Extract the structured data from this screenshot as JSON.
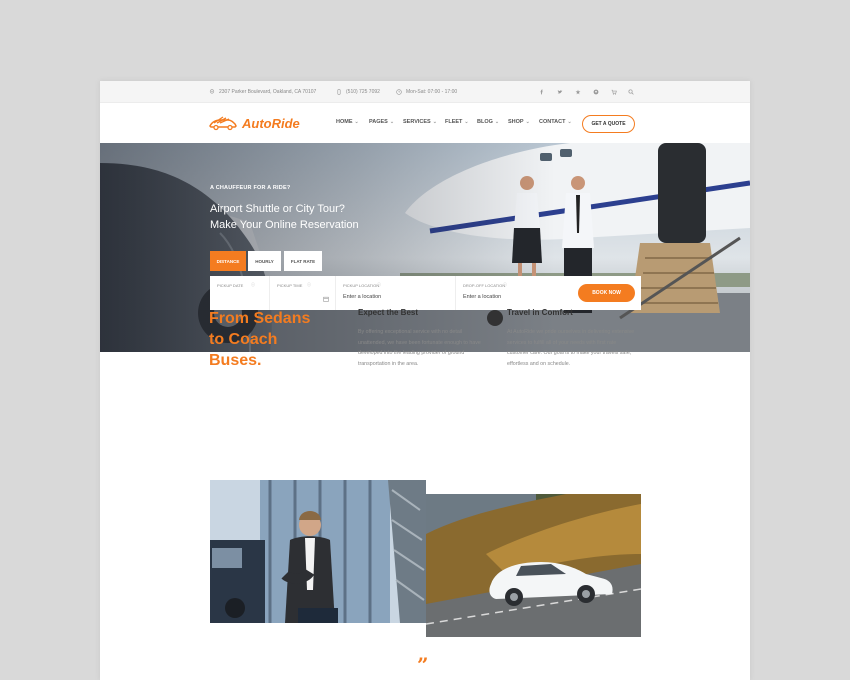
{
  "topbar": {
    "address": "2307 Parker Boulevard, Oakland, CA 70107",
    "phone": "(510) 725 7092",
    "hours": "Mon-Sat: 07:00 - 17:00",
    "social_icons": [
      "facebook-icon",
      "twitter-icon",
      "tripadvisor-icon",
      "pinterest-icon",
      "cart-icon",
      "search-icon"
    ]
  },
  "header": {
    "logo_text": "AutoRide",
    "nav": [
      {
        "label": "HOME"
      },
      {
        "label": "PAGES"
      },
      {
        "label": "SERVICES"
      },
      {
        "label": "FLEET"
      },
      {
        "label": "BLOG"
      },
      {
        "label": "SHOP"
      },
      {
        "label": "CONTACT"
      }
    ],
    "cta": "GET A QUOTE"
  },
  "hero": {
    "eyebrow": "A CHAUFFEUR FOR A RIDE?",
    "title_line1": "Airport Shuttle or City Tour?",
    "title_line2": "Make Your Online Reservation",
    "tabs": [
      "DISTANCE",
      "HOURLY",
      "FLAT RATE"
    ],
    "active_tab": "DISTANCE",
    "form": {
      "pickup_date_label": "PICKUP DATE",
      "pickup_time_label": "PICKUP TIME",
      "pickup_location_label": "PICKUP LOCATION",
      "pickup_location_placeholder": "Enter a location",
      "dropoff_location_label": "DROP-OFF LOCATION",
      "dropoff_location_placeholder": "Enter a location",
      "book_button": "BOOK NOW"
    }
  },
  "intro": {
    "headline_line1": "From Sedans",
    "headline_line2": "to Coach",
    "headline_line3": "Buses.",
    "col1_title": "Expect the Best",
    "col1_text": "By offering exceptional service with no detail unattended, we have been fortunate enough to have developed into the leading provider of ground transportation in the area.",
    "col2_title": "Travel in Comfort",
    "col2_text": "At AutoRide we pride ourselves in delivering extensive services to fulfill all of your needs with first rate customer care. Our goal is to make your travels safe, effortless and on schedule."
  },
  "testimonial": {
    "quote_mark": "”"
  },
  "colors": {
    "accent": "#f47c20",
    "page_background": "#d9d9d9"
  }
}
